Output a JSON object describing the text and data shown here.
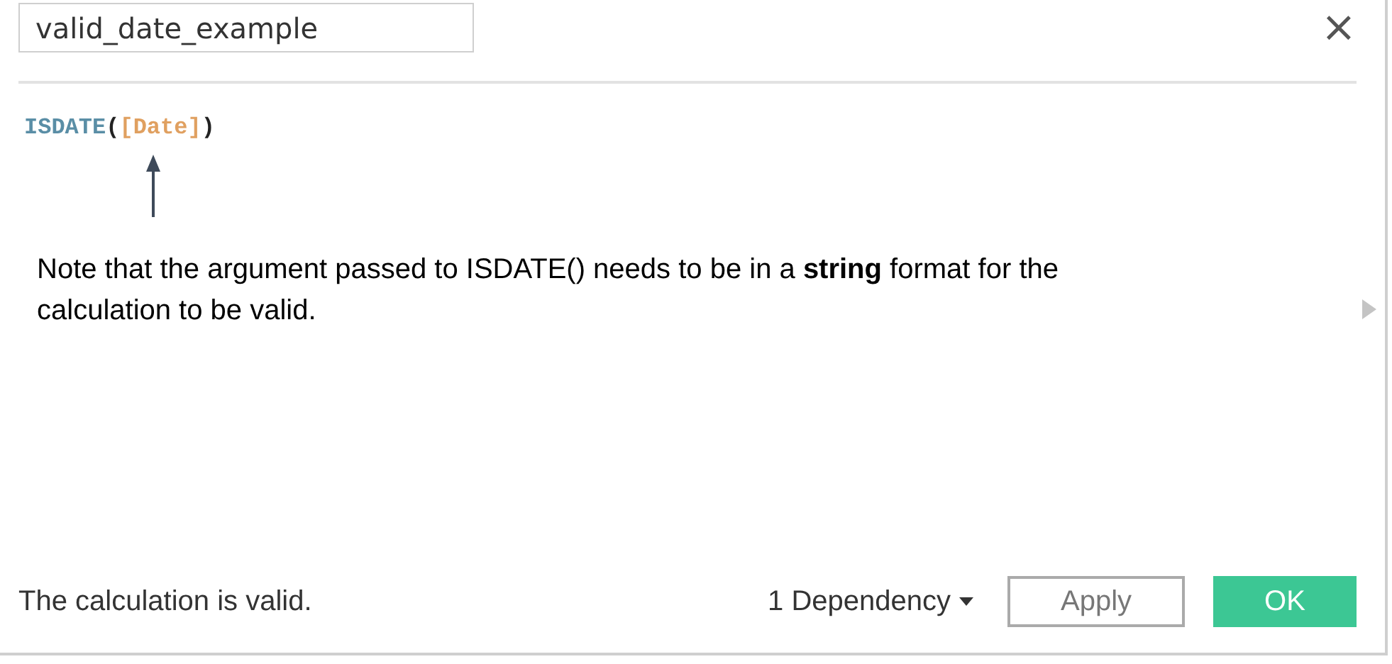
{
  "name_field": {
    "value": "valid_date_example"
  },
  "close_button": {
    "label": "×"
  },
  "formula": [
    {
      "kind": "function",
      "text": "ISDATE"
    },
    {
      "kind": "paren",
      "text": "("
    },
    {
      "kind": "field",
      "text": "[Date]"
    },
    {
      "kind": "paren",
      "text": ")"
    }
  ],
  "annotation": {
    "text": "Note that the argument passed to ISDATE() needs to be in a **string** format for the calculation to be valid."
  },
  "status": "The calculation is valid.",
  "dependency": {
    "label": "1 Dependency"
  },
  "buttons": [
    {
      "kind": "secondary",
      "label": "Apply"
    },
    {
      "kind": "primary",
      "label": "OK"
    }
  ]
}
